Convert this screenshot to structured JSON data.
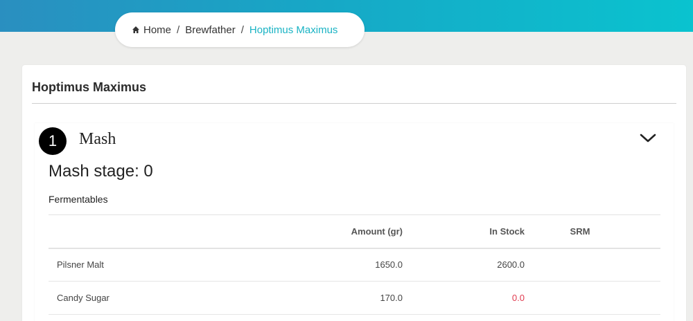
{
  "breadcrumb": {
    "home_label": "Home",
    "parent_label": "Brewfather",
    "current_label": "Hoptimus Maximus",
    "separator": "/"
  },
  "panel": {
    "title": "Hoptimus Maximus"
  },
  "step": {
    "number": "1",
    "title": "Mash",
    "stage_heading": "Mash stage: 0",
    "section_label": "Fermentables"
  },
  "table": {
    "columns": [
      "",
      "Amount (gr)",
      "In Stock",
      "SRM"
    ],
    "rows": [
      {
        "name": "Pilsner Malt",
        "amount": "1650.0",
        "in_stock": "2600.0",
        "srm": ""
      },
      {
        "name": "Candy Sugar",
        "amount": "170.0",
        "in_stock": "0.0",
        "srm": ""
      }
    ]
  },
  "icons": {
    "home": "home-icon",
    "expand": "chevron-down-icon"
  },
  "colors": {
    "header_gradient_start": "#2a8fc0",
    "header_gradient_end": "#0ac3cf",
    "breadcrumb_current": "#19b3c4",
    "low_stock": "#e03a4e",
    "page_background": "#eeeeec"
  }
}
